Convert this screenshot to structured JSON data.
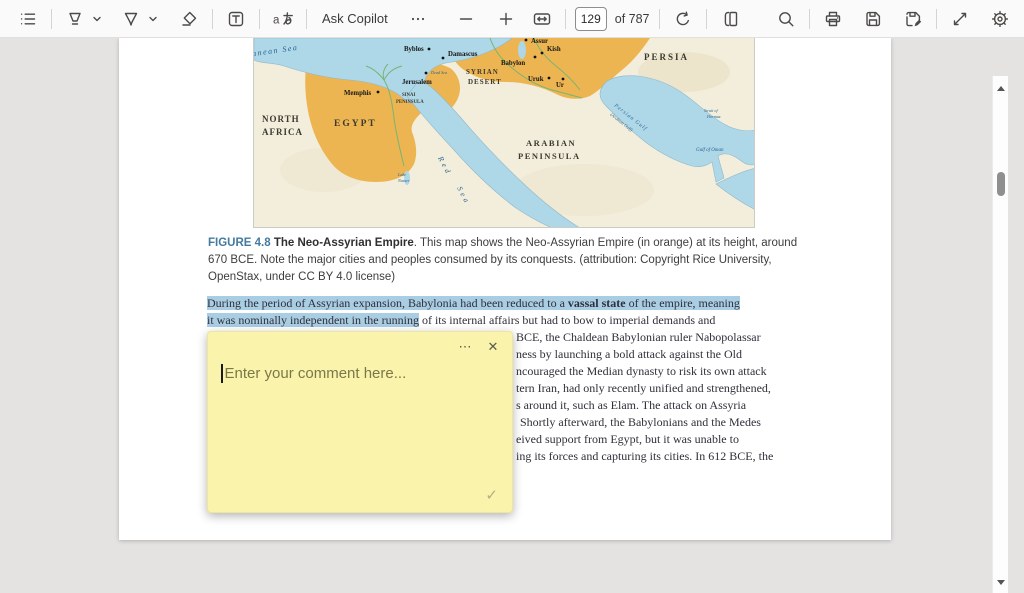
{
  "toolbar": {
    "ask_copilot_label": "Ask Copilot",
    "page_number": "129",
    "page_total_label": "of 787"
  },
  "figure": {
    "caption": {
      "label": "FIGURE 4.8",
      "title": " The Neo-Assyrian Empire",
      "after_title": ". This map shows the Neo-Assyrian Empire (in orange) at its height, around",
      "line2": "670 BCE. Note the major cities and peoples consumed by its conquests. (attribution: Copyright Rice University,",
      "line3": "OpenStax, under CC BY 4.0 license)"
    },
    "map_labels": {
      "mediterranean": "Mediterranean Sea",
      "north_africa_line1": "NORTH",
      "north_africa_line2": "AFRICA",
      "egypt": "EGYPT",
      "sinai_line1": "SINAI",
      "sinai_line2": "PENINSULA",
      "syrian_line1": "SYRIAN",
      "syrian_line2": "DESERT",
      "arabian_line1": "ARABIAN",
      "arabian_line2": "PENINSULA",
      "persia": "PERSIA",
      "red_sea_line1": "Red",
      "red_sea_line2": "Sea",
      "persian_gulf_line1": "Persian Gulf",
      "persian_gulf_line2": "(Arabian Gulf)",
      "hormuz_line1": "Strait of",
      "hormuz_line2": "Hormuz",
      "gulf_of_oman": "Gulf of Oman",
      "lake_nasser_line1": "Lake",
      "lake_nasser_line2": "Nasser",
      "dead_sea": "Dead Sea",
      "byblos": "Byblos",
      "damascus": "Damascus",
      "jerusalem": "Jerusalem",
      "memphis": "Memphis",
      "assur": "Assur",
      "babylon": "Babylon",
      "kish": "Kish",
      "uruk": "Uruk",
      "ur": "Ur"
    }
  },
  "paragraph": {
    "line1_start": "During the period of Assyrian expansion, Babylonia had been reduced to a ",
    "line1_bold": "vassal state",
    "line1_end": " of the empire, meaning",
    "line2_highlighted": "it was nominally independent in the running",
    "line2_rest": " of its internal affairs but had to bow to imperial demands and",
    "visible_fragments": [
      "BCE, the Chaldean Babylonian ruler Nabopolassar",
      "ness by launching a bold attack against the Old",
      "ncouraged the Median dynasty to risk its own attack",
      "tern Iran, had only recently unified and strengthened,",
      "s around it, such as Elam. The attack on Assyria",
      "Shortly afterward, the Babylonians and the Medes",
      "eived support from Egypt, but it was unable to",
      "ing its forces and capturing its cities. In 612 BCE, the"
    ]
  },
  "comment_popup": {
    "placeholder": "Enter your comment here...",
    "more_icon": "⋯",
    "close_icon": "✕",
    "confirm_icon": "✓"
  },
  "colors": {
    "selection_highlight": "#a9cde3",
    "note_background": "#f9f3ac",
    "figure_label": "#447aa0",
    "empire_orange": "#edb551",
    "sea_blue": "#aed7e8"
  }
}
